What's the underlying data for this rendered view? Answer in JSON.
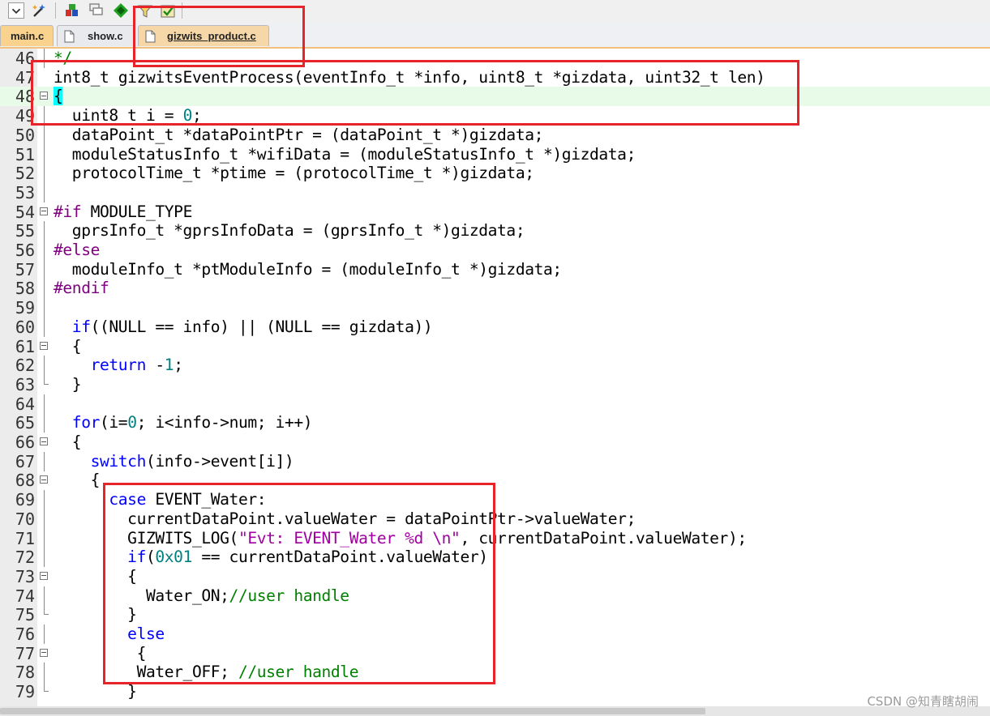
{
  "toolbar": {
    "icons": [
      "dropdown-icon",
      "wizard-icon",
      "download-icon",
      "layers-icon",
      "diamond-icon",
      "filter-icon",
      "options-icon"
    ]
  },
  "tabs": [
    {
      "label": "main.c",
      "active": false
    },
    {
      "label": "show.c",
      "active": false
    },
    {
      "label": "gizwits_product.c",
      "active": true
    }
  ],
  "editor": {
    "current_line": 48,
    "lines": [
      {
        "n": "46",
        "fold": "line",
        "html": "<span class=\"cm\">*/</span>"
      },
      {
        "n": "47",
        "fold": "none",
        "html": "int8_t gizwitsEventProcess(eventInfo_t *info, uint8_t *gizdata, uint32_t len)"
      },
      {
        "n": "48",
        "fold": "box",
        "html": "<span class=\"bm\">{</span>"
      },
      {
        "n": "49",
        "fold": "line",
        "html": "  uint8_t i = <span class=\"num\">0</span>;"
      },
      {
        "n": "50",
        "fold": "line",
        "html": "  dataPoint_t *dataPointPtr = (dataPoint_t *)gizdata;"
      },
      {
        "n": "51",
        "fold": "line",
        "html": "  moduleStatusInfo_t *wifiData = (moduleStatusInfo_t *)gizdata;"
      },
      {
        "n": "52",
        "fold": "line",
        "html": "  protocolTime_t *ptime = (protocolTime_t *)gizdata;"
      },
      {
        "n": "53",
        "fold": "line",
        "html": ""
      },
      {
        "n": "54",
        "fold": "box",
        "html": "<span class=\"pp\">#if</span> MODULE_TYPE"
      },
      {
        "n": "55",
        "fold": "line",
        "html": "  gprsInfo_t *gprsInfoData = (gprsInfo_t *)gizdata;"
      },
      {
        "n": "56",
        "fold": "line",
        "html": "<span class=\"pp\">#else</span>"
      },
      {
        "n": "57",
        "fold": "line",
        "html": "  moduleInfo_t *ptModuleInfo = (moduleInfo_t *)gizdata;"
      },
      {
        "n": "58",
        "fold": "line",
        "html": "<span class=\"pp\">#endif</span>"
      },
      {
        "n": "59",
        "fold": "line",
        "html": ""
      },
      {
        "n": "60",
        "fold": "line",
        "html": "  <span class=\"kw\">if</span>((NULL == info) || (NULL == gizdata))"
      },
      {
        "n": "61",
        "fold": "box",
        "html": "  {"
      },
      {
        "n": "62",
        "fold": "line",
        "html": "    <span class=\"kw\">return</span> -<span class=\"num\">1</span>;"
      },
      {
        "n": "63",
        "fold": "tick",
        "html": "  }"
      },
      {
        "n": "64",
        "fold": "line",
        "html": ""
      },
      {
        "n": "65",
        "fold": "line",
        "html": "  <span class=\"kw\">for</span>(i=<span class=\"num\">0</span>; i&lt;info-&gt;num; i++)"
      },
      {
        "n": "66",
        "fold": "box",
        "html": "  {"
      },
      {
        "n": "67",
        "fold": "line",
        "html": "    <span class=\"kw\">switch</span>(info-&gt;event[i])"
      },
      {
        "n": "68",
        "fold": "box",
        "html": "    {"
      },
      {
        "n": "69",
        "fold": "line",
        "html": "      <span class=\"kw\">case</span> EVENT_Water:"
      },
      {
        "n": "70",
        "fold": "line",
        "html": "        currentDataPoint.valueWater = dataPointPtr-&gt;valueWater;"
      },
      {
        "n": "71",
        "fold": "line",
        "html": "        GIZWITS_LOG(<span class=\"str\">\"Evt: EVENT_Water %d \\n\"</span>, currentDataPoint.valueWater);"
      },
      {
        "n": "72",
        "fold": "line",
        "html": "        <span class=\"kw\">if</span>(<span class=\"num\">0x01</span> == currentDataPoint.valueWater)"
      },
      {
        "n": "73",
        "fold": "box",
        "html": "        {"
      },
      {
        "n": "74",
        "fold": "line",
        "html": "          Water_ON;<span class=\"cm\">//user handle</span>"
      },
      {
        "n": "75",
        "fold": "tick",
        "html": "        }"
      },
      {
        "n": "76",
        "fold": "line",
        "html": "        <span class=\"kw\">else</span>"
      },
      {
        "n": "77",
        "fold": "box",
        "html": "         {"
      },
      {
        "n": "78",
        "fold": "line",
        "html": "         Water_OFF; <span class=\"cm\">//user handle</span>"
      },
      {
        "n": "79",
        "fold": "tick",
        "html": "        }"
      }
    ]
  },
  "watermark": "CSDN @知青瞎胡闹",
  "colors": {
    "annotation_box": "#e8242b",
    "tab_active": "#f6d8a8",
    "tab_main": "#f9d28e",
    "keyword": "#0000ff",
    "preprocessor": "#800080",
    "number": "#008080",
    "comment": "#008000"
  }
}
